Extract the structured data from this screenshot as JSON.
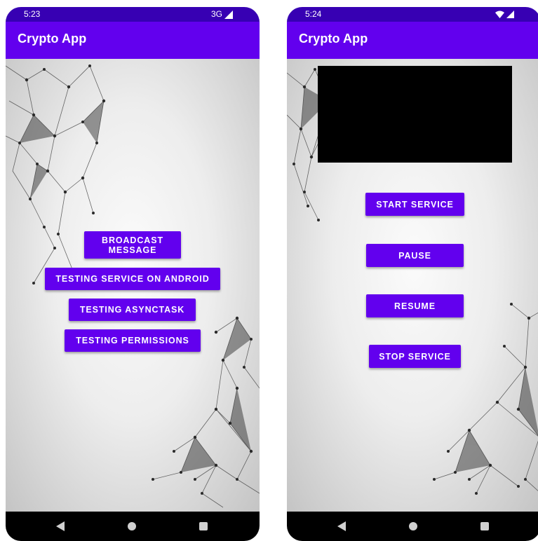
{
  "screens": [
    {
      "status": {
        "time": "5:23",
        "network": "3G"
      },
      "app_title": "Crypto App",
      "buttons": [
        {
          "label": "BROADCAST\nMESSAGE"
        },
        {
          "label": "TESTING SERVICE ON ANDROID"
        },
        {
          "label": "TESTING ASYNCTASK"
        },
        {
          "label": "TESTING PERMISSIONS"
        }
      ]
    },
    {
      "status": {
        "time": "5:24",
        "network": ""
      },
      "app_title": "Crypto App",
      "buttons": [
        {
          "label": "START SERVICE"
        },
        {
          "label": "PAUSE"
        },
        {
          "label": "RESUME"
        },
        {
          "label": "STOP SERVICE"
        }
      ]
    }
  ],
  "icons": {
    "signal": "signal-icon",
    "wifi": "wifi-icon",
    "back": "back-icon",
    "home": "home-icon",
    "recents": "recents-icon"
  },
  "colors": {
    "primary": "#6200ee",
    "primary_dark": "#3700b3",
    "nav_bar": "#000000"
  }
}
